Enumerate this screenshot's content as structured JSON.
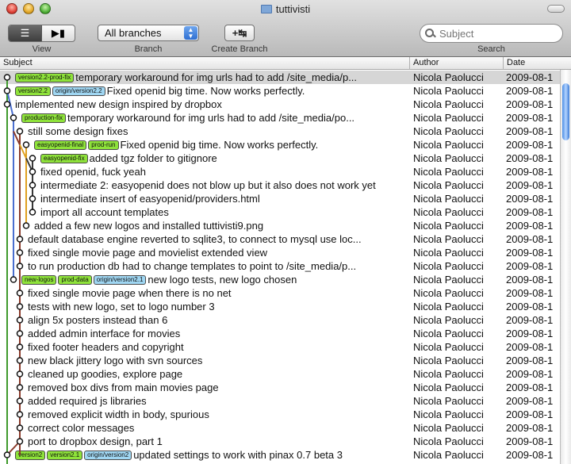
{
  "window": {
    "title": "tuttivisti"
  },
  "toolbar": {
    "view_label": "View",
    "branch_label": "Branch",
    "branch_value": "All branches",
    "create_branch_label": "Create Branch",
    "search_label": "Search",
    "search_placeholder": "Subject"
  },
  "columns": {
    "subject": "Subject",
    "author": "Author",
    "date": "Date"
  },
  "scrollbar": {
    "position": 0.02,
    "visible_fraction": 0.15
  },
  "colors": {
    "local_tag": "#8ee23a",
    "remote_tag": "#9fd6f2",
    "selected_row": "#d6d6d6"
  },
  "commits": [
    {
      "tags": [
        {
          "label": "version2.2-prod-fix",
          "kind": "local"
        }
      ],
      "subject": "temporary workaround for img urls had to add /site_media/p...",
      "author": "Nicola Paolucci",
      "date": "2009-08-1"
    },
    {
      "tags": [
        {
          "label": "version2.2",
          "kind": "local"
        },
        {
          "label": "origin/version2.2",
          "kind": "remote"
        }
      ],
      "subject": "Fixed openid big time. Now works perfectly.",
      "author": "Nicola Paolucci",
      "date": "2009-08-1"
    },
    {
      "tags": [],
      "subject": "implemented new design inspired by dropbox",
      "author": "Nicola Paolucci",
      "date": "2009-08-1"
    },
    {
      "tags": [
        {
          "label": "production-fix",
          "kind": "local"
        }
      ],
      "subject": "temporary workaround for img urls had to add /site_media/po...",
      "author": "Nicola Paolucci",
      "date": "2009-08-1"
    },
    {
      "tags": [],
      "subject": "still some design fixes",
      "author": "Nicola Paolucci",
      "date": "2009-08-1"
    },
    {
      "tags": [
        {
          "label": "easyopenid-final",
          "kind": "local"
        },
        {
          "label": "prod-run",
          "kind": "local"
        }
      ],
      "subject": "Fixed openid big time. Now works perfectly.",
      "author": "Nicola Paolucci",
      "date": "2009-08-1"
    },
    {
      "tags": [
        {
          "label": "easyopenid-fix",
          "kind": "local"
        }
      ],
      "subject": "added tgz folder to gitignore",
      "author": "Nicola Paolucci",
      "date": "2009-08-1"
    },
    {
      "tags": [],
      "subject": "fixed openid, fuck yeah",
      "author": "Nicola Paolucci",
      "date": "2009-08-1"
    },
    {
      "tags": [],
      "subject": "intermediate 2: easyopenid does not blow up but it also does not work yet",
      "author": "Nicola Paolucci",
      "date": "2009-08-1"
    },
    {
      "tags": [],
      "subject": "intermediate insert of easyopenid/providers.html",
      "author": "Nicola Paolucci",
      "date": "2009-08-1"
    },
    {
      "tags": [],
      "subject": "import all account templates",
      "author": "Nicola Paolucci",
      "date": "2009-08-1"
    },
    {
      "tags": [],
      "subject": "added a few new logos and installed tuttivisti9.png",
      "author": "Nicola Paolucci",
      "date": "2009-08-1"
    },
    {
      "tags": [],
      "subject": "default database engine reverted to sqlite3, to connect to mysql use loc...",
      "author": "Nicola Paolucci",
      "date": "2009-08-1"
    },
    {
      "tags": [],
      "subject": "fixed single movie page and movielist extended view",
      "author": "Nicola Paolucci",
      "date": "2009-08-1"
    },
    {
      "tags": [],
      "subject": "to run production db had to change templates to point to /site_media/p...",
      "author": "Nicola Paolucci",
      "date": "2009-08-1"
    },
    {
      "tags": [
        {
          "label": "new-logos",
          "kind": "local"
        },
        {
          "label": "prod-data",
          "kind": "local"
        },
        {
          "label": "origin/version2.1",
          "kind": "remote"
        }
      ],
      "subject": "new logo tests, new logo chosen",
      "author": "Nicola Paolucci",
      "date": "2009-08-1"
    },
    {
      "tags": [],
      "subject": "fixed single movie page when there is no net",
      "author": "Nicola Paolucci",
      "date": "2009-08-1"
    },
    {
      "tags": [],
      "subject": "tests with new logo, set to logo number 3",
      "author": "Nicola Paolucci",
      "date": "2009-08-1"
    },
    {
      "tags": [],
      "subject": "align 5x posters instead than 6",
      "author": "Nicola Paolucci",
      "date": "2009-08-1"
    },
    {
      "tags": [],
      "subject": "added admin interface for movies",
      "author": "Nicola Paolucci",
      "date": "2009-08-1"
    },
    {
      "tags": [],
      "subject": "fixed footer headers and copyright",
      "author": "Nicola Paolucci",
      "date": "2009-08-1"
    },
    {
      "tags": [],
      "subject": "new black jittery logo with svn sources",
      "author": "Nicola Paolucci",
      "date": "2009-08-1"
    },
    {
      "tags": [],
      "subject": "cleaned up goodies, explore page",
      "author": "Nicola Paolucci",
      "date": "2009-08-1"
    },
    {
      "tags": [],
      "subject": "removed box divs from main movies page",
      "author": "Nicola Paolucci",
      "date": "2009-08-1"
    },
    {
      "tags": [],
      "subject": "added required js libraries",
      "author": "Nicola Paolucci",
      "date": "2009-08-1"
    },
    {
      "tags": [],
      "subject": "removed explicit width in body, spurious",
      "author": "Nicola Paolucci",
      "date": "2009-08-1"
    },
    {
      "tags": [],
      "subject": "correct color messages",
      "author": "Nicola Paolucci",
      "date": "2009-08-1"
    },
    {
      "tags": [],
      "subject": "port to dropbox design, part 1",
      "author": "Nicola Paolucci",
      "date": "2009-08-1"
    },
    {
      "tags": [
        {
          "label": "version2",
          "kind": "local"
        },
        {
          "label": "version2.1",
          "kind": "local"
        },
        {
          "label": "origin/version2",
          "kind": "remote"
        }
      ],
      "subject": "updated settings to work with pinax 0.7 beta 3",
      "author": "Nicola Paolucci",
      "date": "2009-08-1"
    }
  ]
}
